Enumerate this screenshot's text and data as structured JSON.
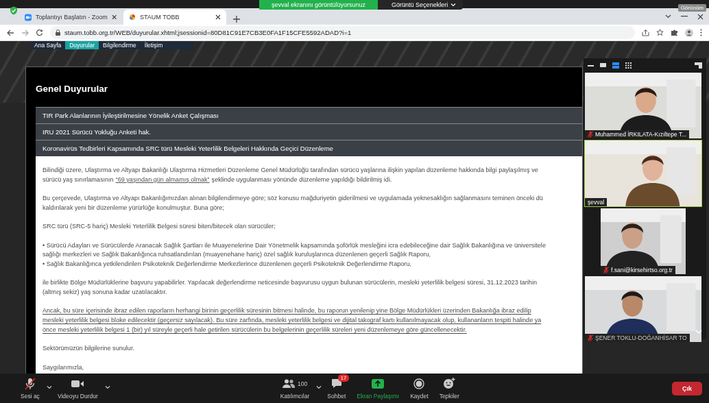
{
  "zoom_banner": {
    "sharing_label": "şevval ekranını görüntülüyorsunuz",
    "view_options": "Görüntü Seçenekleri",
    "view_menu": "Görünüm"
  },
  "browser": {
    "tabs": [
      {
        "title": "Toplantıyı Başlatın - Zoom",
        "selected": false
      },
      {
        "title": "STAUM TOBB",
        "selected": true
      }
    ],
    "url": "staum.tobb.org.tr/WEB/duyurular.xhtml;jsessionid=80D81C91E7CB3E0FA1F15CFE5592ADAD?i=1"
  },
  "site_nav": [
    {
      "label": "Ana Sayfa",
      "selected": false
    },
    {
      "label": "Duyurular",
      "selected": true
    },
    {
      "label": "Bilgilendirme",
      "selected": false
    },
    {
      "label": "İletişim",
      "selected": false
    }
  ],
  "announcements": {
    "title": "Genel Duyurular",
    "items": [
      {
        "title": "TIR Park Alanlarının İyileştirilmesine Yönelik Anket Çalışması"
      },
      {
        "title": "IRU 2021 Sürücü Yokluğu Anketi hak."
      },
      {
        "title": "Koronavirüs Tedbirleri Kapsamında SRC türü Mesleki Yeterlilik Belgeleri Hakkında Geçici Düzenleme",
        "body": [
          {
            "kind": "text",
            "lines": [
              "Bilindiği üzere, Ulaştırma ve Altyapı Bakanlığı Ulaştırma Hizmetleri Düzenleme Genel Müdürlüğü tarafından sürücü yaşlarına ilişkin yapılan düzenleme hakkında bilgi paylaşılmış ve",
              {
                "before": "sürücü yaş sınırlamasının",
                "link": "“69 yaşından gün almamış olmak”",
                "after": "şeklinde uygulanması yönünde düzenleme yapıldığı bildirilmiş idi."
              }
            ]
          },
          {
            "kind": "text",
            "lines": [
              "Bu çerçevede, Ulaştırma ve Altyapı Bakanlığımızdan alınan bilgilendirmeye göre; söz konusu mağduriyetin giderilmesi ve uygulamada yeknesaklığın sağlanmasını teminen önceki dü",
              "kaldırılarak yeni bir düzenleme yürürlüğe konulmuştur. Buna göre;"
            ]
          },
          {
            "kind": "text",
            "lines": [
              "SRC türü (SRC-5 hariç) Mesleki Yeterlilik Belgesi süresi biten/bitecek olan sürücüler;"
            ]
          },
          {
            "kind": "text",
            "lines": [
              "• Sürücü Adayları ve Sürücülerde Aranacak Sağlık Şartları ile Muayenelerine Dair Yönetmelik kapsamında şoförlük mesleğini icra edebileceğine dair Sağlık Bakanlığına ve üniversitele",
              "sağlığı merkezleri ve Sağlık Bakanlığınca ruhsatlandırılan (muayenehane hariç) özel sağlık kuruluşlarınca düzenlenen geçerli Sağlık Raporu,",
              "• Sağlık Bakanlığınca yetkilendirilen Psikoteknik Değerlendirme Merkezlerince düzenlenen geçerli Psikoteknik Değerlendirme Raporu,"
            ]
          },
          {
            "kind": "text",
            "lines": [
              "ile birlikte Bölge Müdürlüklerine başvuru yapabilirler. Yapılacak değerlendirme neticesinde başvurusu uygun bulunan sürücülerin, mesleki yeterlilik belgesi süresi, 31.12.2023 tarihin",
              "(altmış sekiz) yaş sonuna kadar uzatılacaktır."
            ]
          },
          {
            "kind": "notice",
            "lines": [
              "Ancak, bu süre içerisinde ibraz edilen raporların herhangi birinin geçerlilik süresinin bitmesi halinde, bu raporun yenilenip yine Bölge Müdürlükleri üzerinden Bakanlığa ibraz edilip",
              "mesleki yeterlilik belgesi bloke edilecektir (geçersiz sayılacak). Bu süre zarfında, mesleki yeterlilik belgesi ve dijital takograf kartı kullanılmayacak olup, kullananların tespiti halinde ya",
              "önce mesleki yeterlilik belgesi 1 (bir) yıl süreyle geçerli hale getirilen sürücülerin bu belgelerinin geçerlilik süreleri yeni düzenlemeye göre güncellenecektir."
            ]
          },
          {
            "kind": "text",
            "lines": [
              "Sektörümüzün bilgilerine sunulur."
            ]
          },
          {
            "kind": "text",
            "lines": [
              "Saygılarımızla,"
            ]
          }
        ]
      }
    ]
  },
  "gallery": {
    "tiles": [
      {
        "name": "Muhammed İRKILATA-Kızıltepe T...",
        "muted": true,
        "speaking": false,
        "letterboxed": false
      },
      {
        "name": "şevval",
        "muted": false,
        "speaking": true,
        "letterboxed": false
      },
      {
        "name": "f.sani@kirsehirtso.org.tr",
        "muted": true,
        "speaking": false,
        "letterboxed": true
      },
      {
        "name": "ŞENER TOKLU-DOĞANHİSAR TO",
        "muted": true,
        "speaking": false,
        "letterboxed": false
      }
    ]
  },
  "toolbar": {
    "items": [
      {
        "kind": "mic",
        "label": "Sesi aç",
        "muted": true,
        "menu": true
      },
      {
        "kind": "video",
        "label": "Videoyu Durdur",
        "menu": true
      },
      {
        "kind": "participants",
        "label": "Katılımcılar",
        "count": "100",
        "menu": true
      },
      {
        "kind": "chat",
        "label": "Sohbet",
        "badge": "17",
        "menu": false
      },
      {
        "kind": "share",
        "label": "Ekran Paylaşımı",
        "menu": false
      },
      {
        "kind": "record",
        "label": "Kaydet",
        "menu": false
      },
      {
        "kind": "reactions",
        "label": "Tepkiler",
        "menu": false
      }
    ],
    "leave": "Çık"
  }
}
